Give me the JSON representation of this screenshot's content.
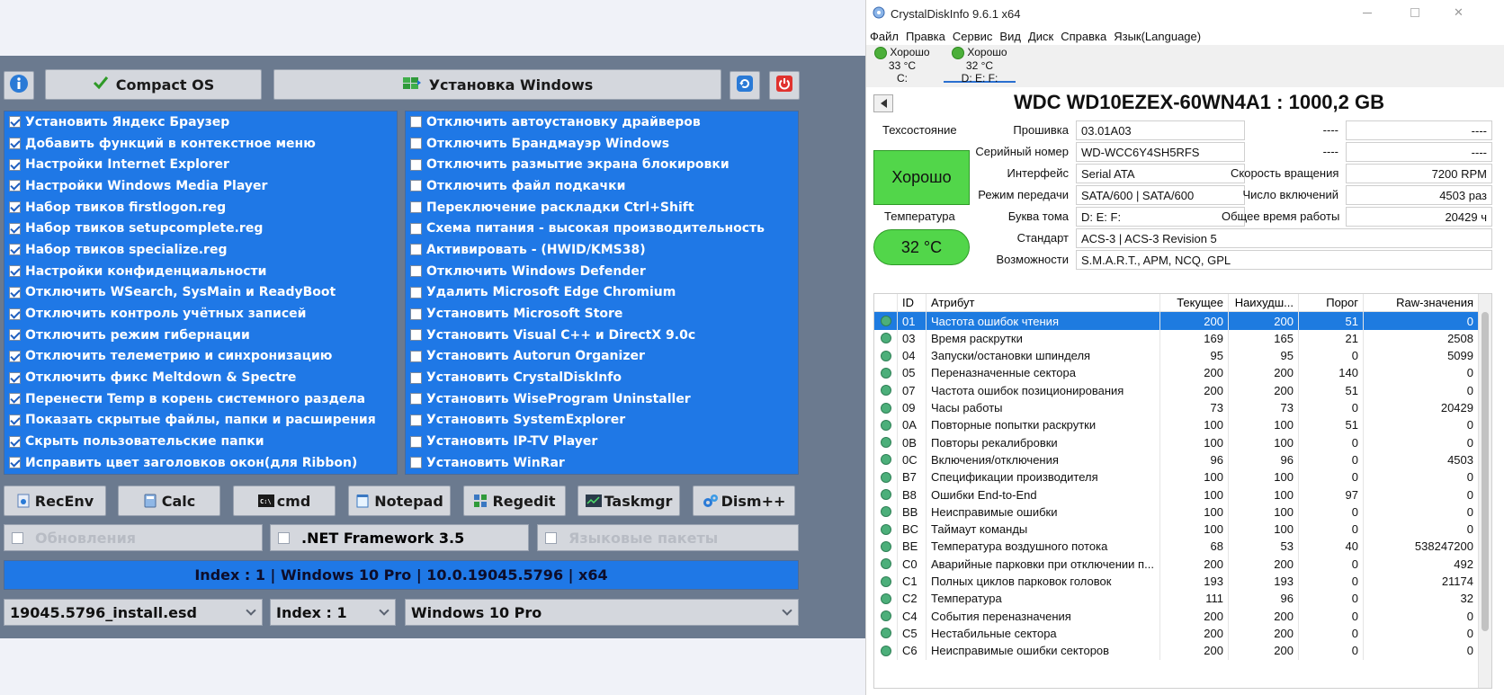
{
  "tool": {
    "compact_os_label": "Compact OS",
    "install_windows_label": "Установка Windows",
    "left_items": [
      {
        "label": "Установить Яндекс Браузер",
        "checked": true
      },
      {
        "label": "Добавить функций в контекстное меню",
        "checked": true
      },
      {
        "label": "Настройки Internet Explorer",
        "checked": true
      },
      {
        "label": "Настройки Windows Media Player",
        "checked": true
      },
      {
        "label": "Набор твиков firstlogon.reg",
        "checked": true
      },
      {
        "label": "Набор твиков setupcomplete.reg",
        "checked": true
      },
      {
        "label": "Набор твиков specialize.reg",
        "checked": true
      },
      {
        "label": "Настройки конфиденциальности",
        "checked": true
      },
      {
        "label": "Отключить WSearch, SysMain и ReadyBoot",
        "checked": true
      },
      {
        "label": "Отключить контроль учётных записей",
        "checked": true
      },
      {
        "label": "Отключить режим гибернации",
        "checked": true
      },
      {
        "label": "Отключить телеметрию и синхронизацию",
        "checked": true
      },
      {
        "label": "Отключить фикс Meltdown & Spectre",
        "checked": true
      },
      {
        "label": "Перенести Temp в корень системного раздела",
        "checked": true
      },
      {
        "label": "Показать скрытые файлы, папки и расширения",
        "checked": true
      },
      {
        "label": "Скрыть пользовательские папки",
        "checked": true
      },
      {
        "label": "Исправить цвет заголовков окон(для Ribbon)",
        "checked": true
      }
    ],
    "right_items": [
      {
        "label": "Отключить автоустановку драйверов",
        "checked": false
      },
      {
        "label": "Отключить Брандмауэр Windows",
        "checked": false
      },
      {
        "label": "Отключить размытие экрана блокировки",
        "checked": false
      },
      {
        "label": "Отключить файл подкачки",
        "checked": false
      },
      {
        "label": "Переключение раскладки Ctrl+Shift",
        "checked": false
      },
      {
        "label": "Схема питания - высокая производительность",
        "checked": false
      },
      {
        "label": "Активировать - (HWID/KMS38)",
        "checked": false
      },
      {
        "label": "Отключить Windows Defender",
        "checked": false
      },
      {
        "label": "Удалить Microsoft Edge Chromium",
        "checked": false
      },
      {
        "label": "Установить Microsoft Store",
        "checked": false
      },
      {
        "label": "Установить Visual C++ и DirectX 9.0c",
        "checked": false
      },
      {
        "label": "Установить Autorun Organizer",
        "checked": false
      },
      {
        "label": "Установить CrystalDiskInfo",
        "checked": false
      },
      {
        "label": "Установить WiseProgram Uninstaller",
        "checked": false
      },
      {
        "label": "Установить SystemExplorer",
        "checked": false
      },
      {
        "label": "Установить IP-TV Player",
        "checked": false
      },
      {
        "label": "Установить WinRar",
        "checked": false
      }
    ],
    "utilities": [
      "RecEnv",
      "Calc",
      "cmd",
      "Notepad",
      "Regedit",
      "Taskmgr",
      "Dism++"
    ],
    "options": [
      {
        "label": "Обновления",
        "enabled": false
      },
      {
        "label": ".NET Framework 3.5",
        "enabled": true
      },
      {
        "label": "Языковые пакеты",
        "enabled": false
      }
    ],
    "index_info": "Index : 1 | Windows 10 Pro | 10.0.19045.5796 | x64",
    "image_file": "19045.5796_install.esd",
    "index_select": "Index : 1",
    "edition_select": "Windows 10 Pro"
  },
  "cdi": {
    "title": "CrystalDiskInfo 9.6.1 x64",
    "menu": [
      "Файл",
      "Правка",
      "Сервис",
      "Вид",
      "Диск",
      "Справка",
      "Язык(Language)"
    ],
    "drives": [
      {
        "status": "Хорошо",
        "temp": "33 °C",
        "letter": "C:"
      },
      {
        "status": "Хорошо",
        "temp": "32 °C",
        "letter": "D: E: F:"
      }
    ],
    "disk_title": "WDC WD10EZEX-60WN4A1 : 1000,2 GB",
    "health_label": "Техсостояние",
    "health_value": "Хорошо",
    "temp_label": "Температура",
    "temp_value": "32 °C",
    "firmware_label": "Прошивка",
    "firmware": "03.01A03",
    "serial_label": "Серийный номер",
    "serial": "WD-WCC6Y4SH5RFS",
    "interface_label": "Интерфейс",
    "interface": "Serial ATA",
    "transfer_label": "Режим передачи",
    "transfer": "SATA/600 | SATA/600",
    "volume_label": "Буква тома",
    "volume": "D: E: F:",
    "standard_label": "Стандарт",
    "standard": "ACS-3 | ACS-3 Revision 5",
    "features_label": "Возможности",
    "features": "S.M.A.R.T., APM, NCQ, GPL",
    "blank1": "----",
    "blank1v": "----",
    "blank2": "----",
    "blank2v": "----",
    "rpm_label": "Скорость вращения",
    "rpm": "7200 RPM",
    "power_count_label": "Число включений",
    "power_count": "4503 раз",
    "power_hours_label": "Общее время работы",
    "power_hours": "20429 ч",
    "columns": [
      "ID",
      "Атрибут",
      "Текущее",
      "Наихудш...",
      "Порог",
      "Raw-значения"
    ],
    "rows": [
      [
        "01",
        "Частота ошибок чтения",
        "200",
        "200",
        "51",
        "0"
      ],
      [
        "03",
        "Время раскрутки",
        "169",
        "165",
        "21",
        "2508"
      ],
      [
        "04",
        "Запуски/остановки шпинделя",
        "95",
        "95",
        "0",
        "5099"
      ],
      [
        "05",
        "Переназначенные сектора",
        "200",
        "200",
        "140",
        "0"
      ],
      [
        "07",
        "Частота ошибок позиционирования",
        "200",
        "200",
        "51",
        "0"
      ],
      [
        "09",
        "Часы работы",
        "73",
        "73",
        "0",
        "20429"
      ],
      [
        "0A",
        "Повторные попытки раскрутки",
        "100",
        "100",
        "51",
        "0"
      ],
      [
        "0B",
        "Повторы рекалибровки",
        "100",
        "100",
        "0",
        "0"
      ],
      [
        "0C",
        "Включения/отключения",
        "96",
        "96",
        "0",
        "4503"
      ],
      [
        "B7",
        "Спецификации производителя",
        "100",
        "100",
        "0",
        "0"
      ],
      [
        "B8",
        "Ошибки End-to-End",
        "100",
        "100",
        "97",
        "0"
      ],
      [
        "BB",
        "Неисправимые ошибки",
        "100",
        "100",
        "0",
        "0"
      ],
      [
        "BC",
        "Таймаут команды",
        "100",
        "100",
        "0",
        "0"
      ],
      [
        "BE",
        "Температура воздушного потока",
        "68",
        "53",
        "40",
        "538247200"
      ],
      [
        "C0",
        "Аварийные парковки при отключении п...",
        "200",
        "200",
        "0",
        "492"
      ],
      [
        "C1",
        "Полных циклов парковок головок",
        "193",
        "193",
        "0",
        "21174"
      ],
      [
        "C2",
        "Температура",
        "111",
        "96",
        "0",
        "32"
      ],
      [
        "C4",
        "События переназначения",
        "200",
        "200",
        "0",
        "0"
      ],
      [
        "C5",
        "Нестабильные сектора",
        "200",
        "200",
        "0",
        "0"
      ],
      [
        "C6",
        "Неисправимые ошибки секторов",
        "200",
        "200",
        "0",
        "0"
      ]
    ]
  }
}
